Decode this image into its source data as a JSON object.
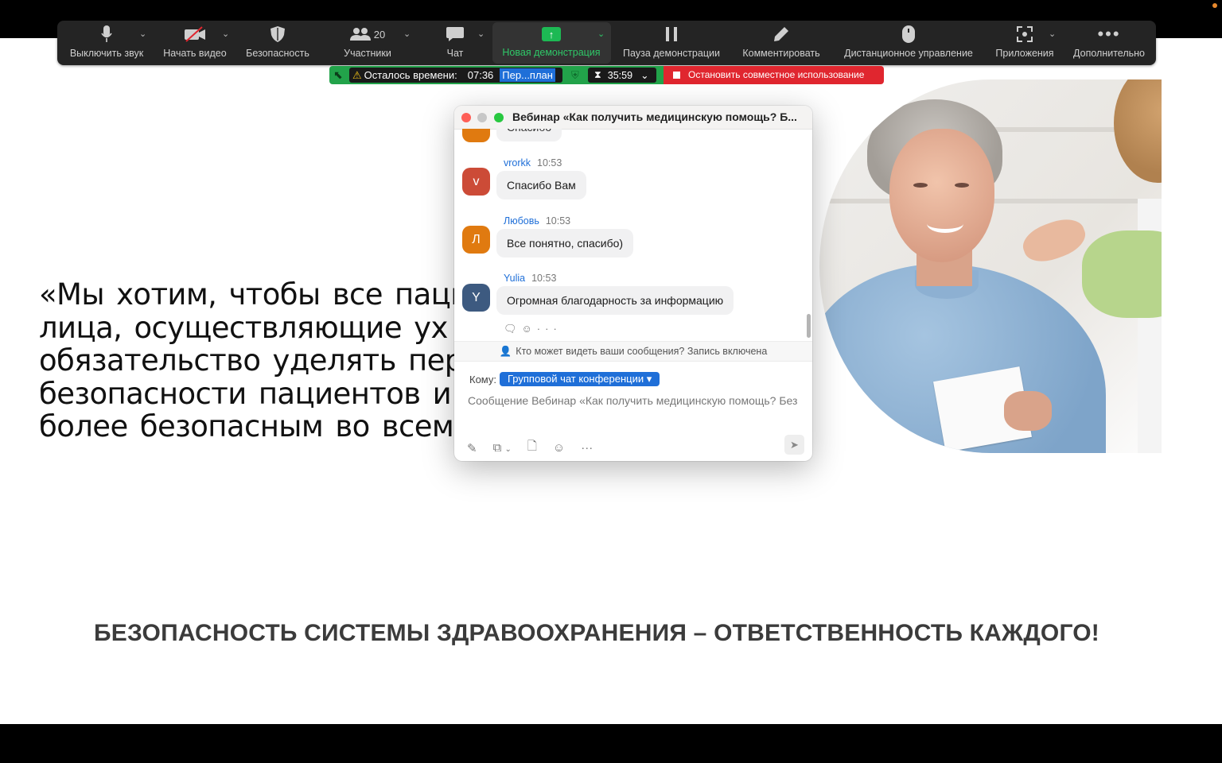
{
  "toolbar": {
    "mute": "Выключить звук",
    "video": "Начать видео",
    "security": "Безопасность",
    "participants": "Участники",
    "participants_count": "20",
    "chat": "Чат",
    "share": "Новая демонстрация",
    "pause": "Пауза демонстрации",
    "annotate": "Комментировать",
    "remote": "Дистанционное управление",
    "apps": "Приложения",
    "more": "Дополнительно"
  },
  "status": {
    "remaining_label": "Осталось времени:",
    "remaining_value": "07:36",
    "plan": "Пер...план",
    "timer": "35:59",
    "stop": "Остановить совместное использование"
  },
  "chat": {
    "title": "Вебинар «Как получить медицинскую помощь? Б...",
    "partial_message": "Спасибо",
    "messages": [
      {
        "name": "vrorkk",
        "time": "10:53",
        "text": "Спасибо Вам",
        "initial": "v",
        "color": "#cc4b37"
      },
      {
        "name": "Любовь",
        "time": "10:53",
        "text": "Все понятно, спасибо)",
        "initial": "Л",
        "color": "#e07a10"
      },
      {
        "name": "Yulia",
        "time": "10:53",
        "text": "Огромная благодарность за информацию",
        "initial": "Y",
        "color": "#3d5a80"
      }
    ],
    "privacy_notice": "Кто может видеть ваши сообщения? Запись включена",
    "to_label": "Кому:",
    "to_value": "Групповой чат конференции",
    "placeholder": "Сообщение Вебинар «Как получить медицинскую помощь? Без"
  },
  "slide": {
    "quote_lines": [
      "«Мы хотим, чтобы все паци",
      "лица, осуществляющие ух",
      "обязательство уделять пер",
      "безопасности пациентов и сд",
      "более безопасным во всем ми"
    ],
    "headline": "БЕЗОПАСНОСТЬ СИСТЕМЫ ЗДРАВООХРАНЕНИЯ – ОТВЕТСТВЕННОСТЬ КАЖДОГО!"
  }
}
